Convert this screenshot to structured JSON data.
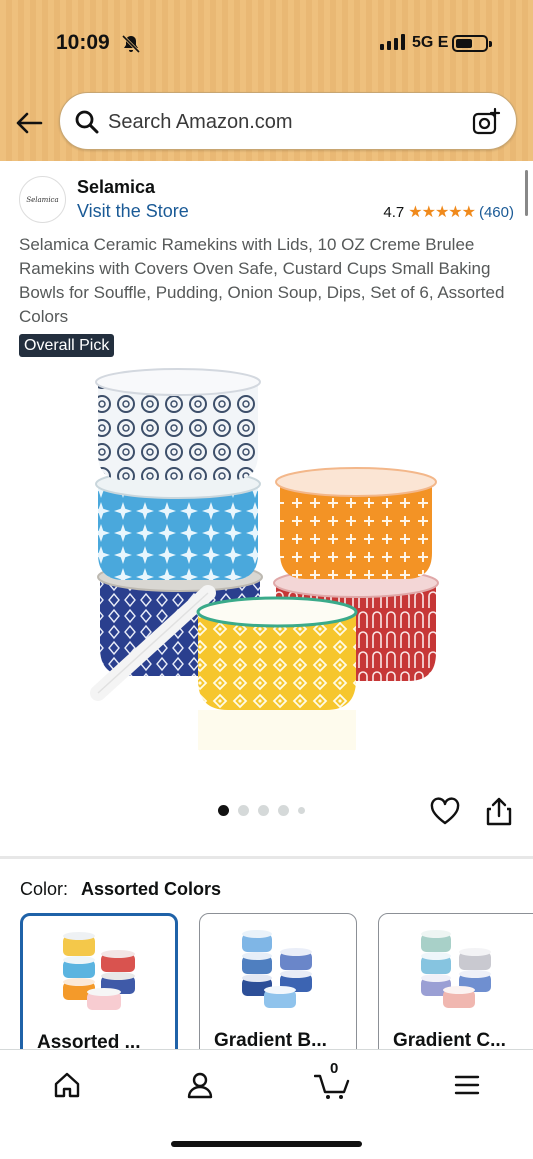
{
  "status": {
    "time": "10:09",
    "network": "5G E"
  },
  "search": {
    "placeholder": "Search Amazon.com"
  },
  "store": {
    "logo_text": "Selamica",
    "name": "Selamica",
    "link": "Visit the Store",
    "rating": "4.7",
    "stars": "★★★★★",
    "review_count": "(460)"
  },
  "product": {
    "title": "Selamica Ceramic Ramekins with Lids, 10 OZ Creme Brulee Ramekins with Covers Oven Safe, Custard Cups Small Baking Bowls for Souffle, Pudding, Onion Soup, Dips, Set of 6, Assorted Colors",
    "badge": "Overall Pick",
    "image_count": 5,
    "active_image": 1
  },
  "color": {
    "label": "Color:",
    "selected": "Assorted Colors",
    "options": [
      {
        "label": "Assorted ...",
        "selected": true
      },
      {
        "label": "Gradient B...",
        "selected": false
      },
      {
        "label": "Gradient C...",
        "selected": false
      }
    ]
  },
  "bottom_nav": {
    "cart_count": "0"
  },
  "colors": {
    "header": "#eec07d",
    "link": "#1a5a96",
    "star": "#f08a1c",
    "selected_border": "#1f62a8",
    "badge_bg": "#232f3e"
  },
  "icons": [
    "back-arrow-icon",
    "search-icon",
    "camera-icon",
    "heart-icon",
    "share-icon",
    "home-icon",
    "account-icon",
    "cart-icon",
    "menu-icon",
    "bell-slash-icon",
    "signal-icon",
    "battery-icon"
  ]
}
